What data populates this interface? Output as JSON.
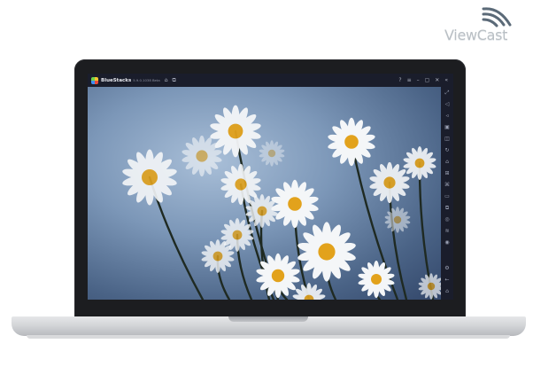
{
  "watermark": {
    "brand": "ViewCast",
    "icon": "signal-waves-icon"
  },
  "window": {
    "app_name": "BlueStacks",
    "version": "5.9.0.1038 Beta",
    "toolbar_icons": [
      "home-icon",
      "multi-instance-icon"
    ],
    "controls": [
      "help-icon",
      "menu-icon",
      "minimize-icon",
      "maximize-icon",
      "close-icon",
      "collapse-sidebar-icon"
    ]
  },
  "sidebar_icons": [
    "fullscreen-icon",
    "volume-up-icon",
    "volume-down-icon",
    "screen-record-icon",
    "screenshot-icon",
    "rotate-icon",
    "shake-icon",
    "gamepad-icon",
    "macro-icon",
    "folder-icon",
    "multi-instance-sync-icon",
    "eco-mode-icon",
    "layers-icon",
    "location-icon",
    "settings-icon",
    "back-icon",
    "home-nav-icon",
    "recent-apps-icon"
  ],
  "colors": {
    "titlebar": "#1a1d2b",
    "sky": "#7c97b8",
    "petal": "#f4f6f8",
    "flower_center": "#e2a21c",
    "stem": "#1f2a22"
  }
}
